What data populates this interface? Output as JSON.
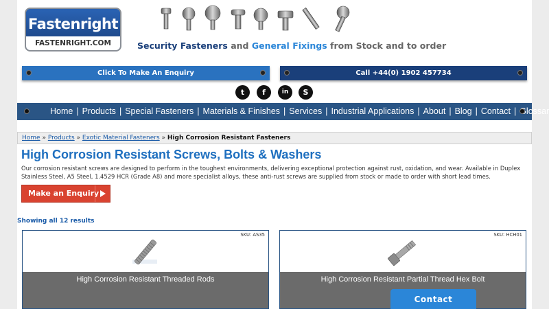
{
  "header": {
    "logo_text": "Fastenright",
    "logo_url_text": "FASTENRIGHT.COM",
    "tagline": {
      "part1": "Security Fasteners",
      "part2": " and ",
      "part3": "General Fixings",
      "part4": " from Stock and to order"
    }
  },
  "top_bars": {
    "enquiry_label": "Click To Make An Enquiry",
    "call_label": "Call +44(0) 1902 457734"
  },
  "social": [
    {
      "icon": "twitter-icon",
      "glyph": "t"
    },
    {
      "icon": "facebook-icon",
      "glyph": "f"
    },
    {
      "icon": "linkedin-icon",
      "glyph": "in"
    },
    {
      "icon": "skype-icon",
      "glyph": "S"
    }
  ],
  "nav": {
    "items": [
      "Home",
      "Products",
      "Special Fasteners",
      "Materials & Finishes",
      "Services",
      "Industrial Applications",
      "About",
      "Blog",
      "Contact",
      "Glossary"
    ]
  },
  "breadcrumb": {
    "home": "Home",
    "sep": " » ",
    "products": "Products",
    "category": "Exotic Material Fasteners",
    "current": "High Corrosion Resistant Fasteners"
  },
  "main": {
    "title": "High Corrosion Resistant Screws, Bolts & Washers",
    "intro": "Our corrosion resistant screws are designed to perform in the toughest environments, delivering exceptional protection against rust, oxidation, and wear. Available in Duplex Stainless Steel, A5 Steel, 1.4529 HCR (Grade A8) and more specialist alloys, these anti-rust screws are supplied from stock or made to order with short lead times.",
    "enquiry_button": "Make an Enquiry",
    "results_text": "Showing all 12 results"
  },
  "products": [
    {
      "sku": "SKU: AS35",
      "name": "High Corrosion Resistant Threaded Rods"
    },
    {
      "sku": "SKU: HCH01",
      "name": "High Corrosion Resistant Partial Thread Hex Bolt"
    }
  ],
  "contact_tab": "Contact",
  "colors": {
    "nav_blue": "#2a5585",
    "title_blue": "#1e6fbf",
    "enquiry_red": "#d94330",
    "contact_blue": "#2b86d8"
  }
}
